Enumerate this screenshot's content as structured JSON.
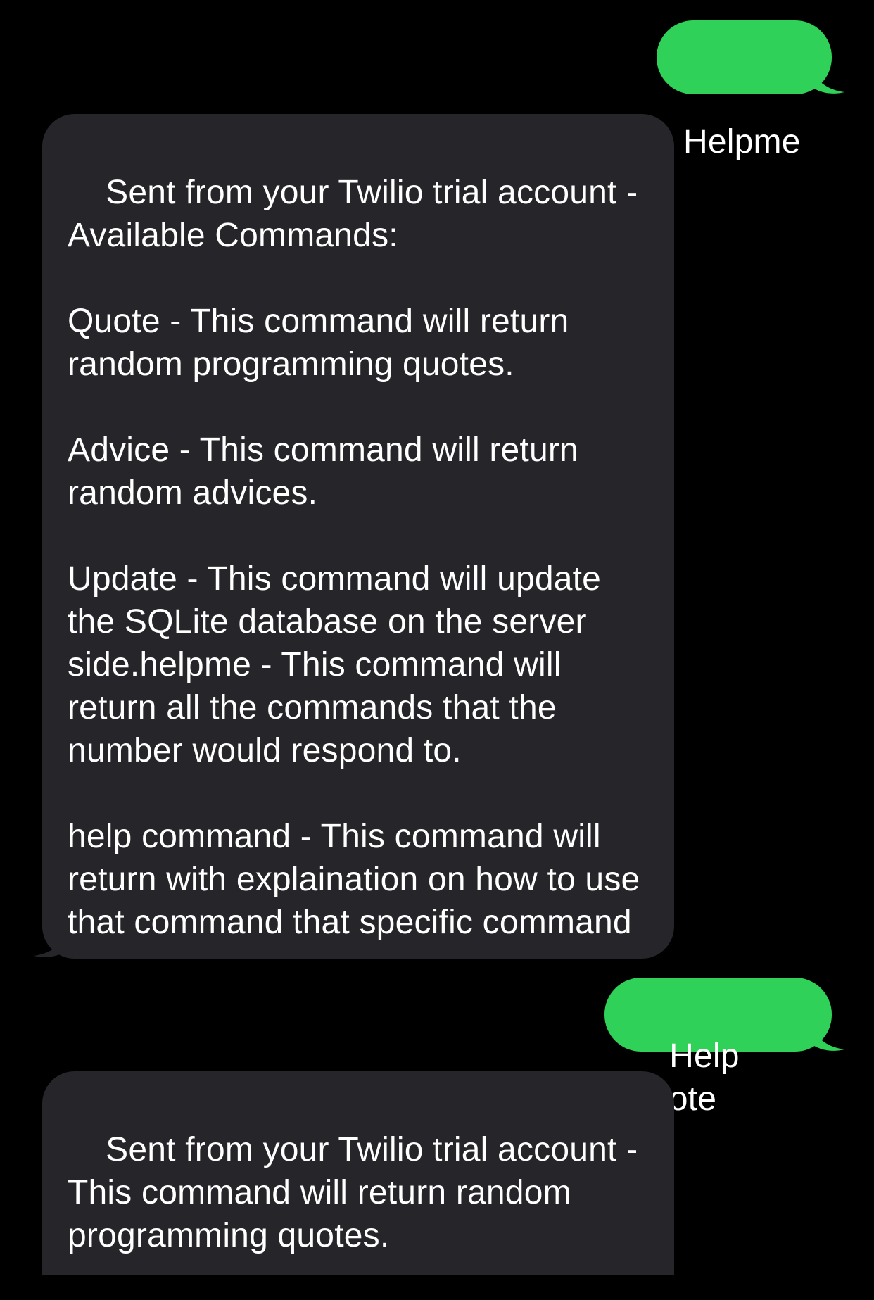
{
  "messages": {
    "out1": {
      "text": "Helpme"
    },
    "in1": {
      "text": "Sent from your Twilio trial account - Available Commands:\n\nQuote - This command will return random programming quotes.\n\nAdvice - This command will return random advices.\n\nUpdate - This command will update the SQLite database on the server side.helpme - This command will return all the commands that the number would respond to.\n\nhelp command - This command will return with explaination on how to use that command that specific command"
    },
    "out2": {
      "text": "Help quote"
    },
    "in2": {
      "text": "Sent from your Twilio trial account - This command will return random programming quotes."
    }
  },
  "colors": {
    "background": "#000000",
    "outgoing_bubble": "#30d158",
    "incoming_bubble": "#26262a",
    "text": "#ffffff"
  }
}
